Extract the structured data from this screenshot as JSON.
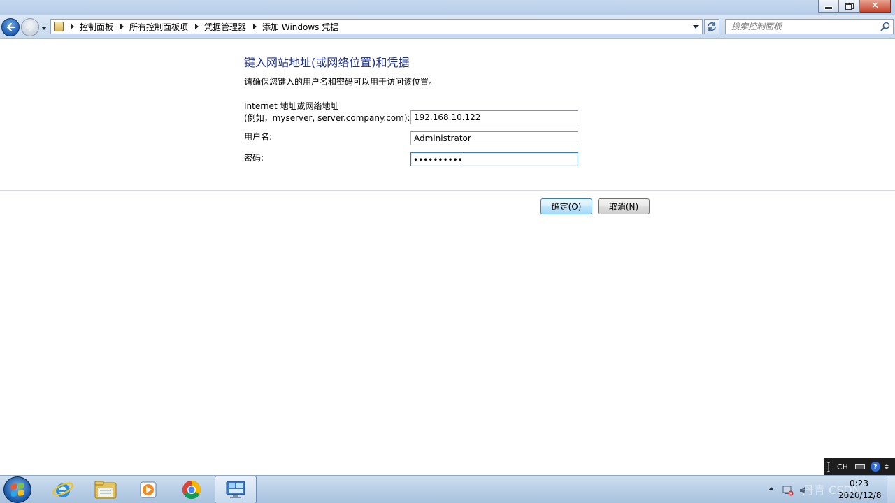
{
  "navigation": {
    "breadcrumbs": [
      "控制面板",
      "所有控制面板项",
      "凭据管理器",
      "添加 Windows 凭据"
    ],
    "search_placeholder": "搜索控制面板"
  },
  "form": {
    "heading": "键入网站地址(或网络位置)和凭据",
    "subtitle": "请确保您键入的用户名和密码可以用于访问该位置。",
    "address_label_line1": "Internet 地址或网络地址",
    "address_label_line2": "(例如，myserver, server.company.com):",
    "address_value": "192.168.10.122",
    "username_label": "用户名:",
    "username_value": "Administrator",
    "password_label": "密码:",
    "password_masked": "••••••••••"
  },
  "buttons": {
    "ok_label": "确定(O)",
    "cancel_label": "取消(N)"
  },
  "language_bar": {
    "lang": "CH"
  },
  "taskbar": {
    "items": [
      "ie-icon",
      "explorer-icon",
      "media-player-icon",
      "chrome-icon",
      "control-panel-icon"
    ],
    "clock_time": "0:23",
    "clock_date": "2020/12/8"
  },
  "watermark": "丹青 CSDN"
}
